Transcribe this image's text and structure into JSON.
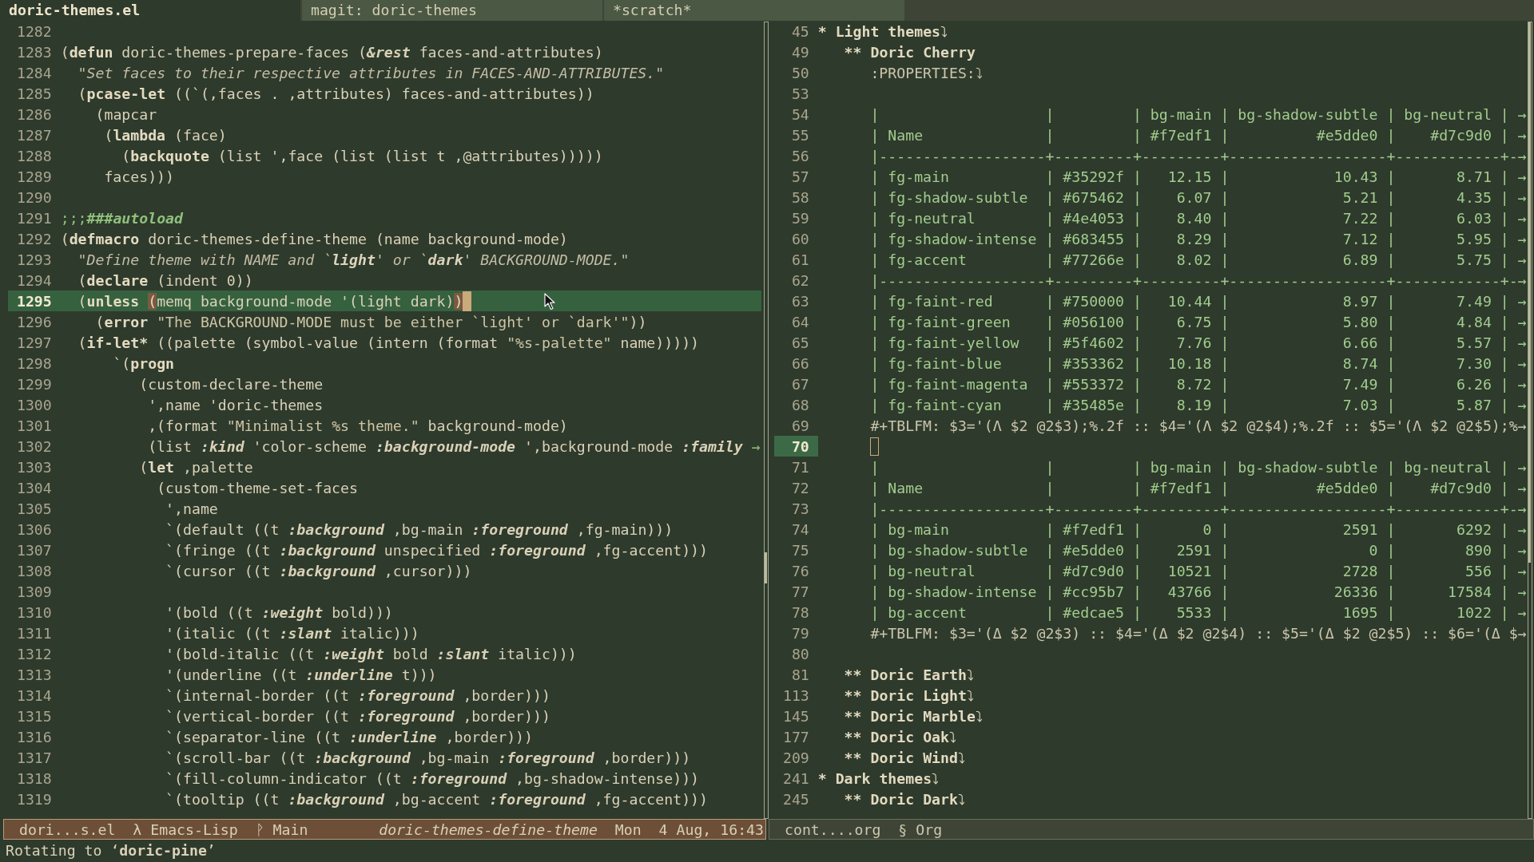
{
  "tab_bar": {
    "tabs": [
      {
        "label": "doric-themes.el",
        "selected": true
      },
      {
        "label": "magit: doric-themes",
        "selected": false
      },
      {
        "label": "*scratch*",
        "selected": false
      }
    ]
  },
  "left_window": {
    "active": true,
    "lines": [
      {
        "number": "1282",
        "current": false
      },
      {
        "number": "1283",
        "current": false,
        "segments": [
          {
            "kind": "plain",
            "text": "("
          },
          {
            "kind": "keyword",
            "text": "defun"
          },
          {
            "kind": "plain",
            "text": " doric-themes-prepare-faces ("
          },
          {
            "kind": "property",
            "text": "&rest"
          },
          {
            "kind": "plain",
            "text": " faces-and-attributes)"
          }
        ]
      },
      {
        "number": "1284",
        "current": false,
        "segments": [
          {
            "kind": "doc",
            "text": "  \"Set faces to their respective attributes in FACES-AND-ATTRIBUTES.\""
          }
        ]
      },
      {
        "number": "1285",
        "current": false,
        "segments": [
          {
            "kind": "plain",
            "text": "  ("
          },
          {
            "kind": "keyword",
            "text": "pcase-let"
          },
          {
            "kind": "plain",
            "text": " ((`(,faces . ,attributes) faces-and-attributes))"
          }
        ]
      },
      {
        "number": "1286",
        "current": false,
        "segments": [
          {
            "kind": "plain",
            "text": "    (mapcar"
          }
        ]
      },
      {
        "number": "1287",
        "current": false,
        "segments": [
          {
            "kind": "plain",
            "text": "     ("
          },
          {
            "kind": "keyword",
            "text": "lambda"
          },
          {
            "kind": "plain",
            "text": " (face)"
          }
        ]
      },
      {
        "number": "1288",
        "current": false,
        "segments": [
          {
            "kind": "plain",
            "text": "       ("
          },
          {
            "kind": "keyword",
            "text": "backquote"
          },
          {
            "kind": "plain",
            "text": " (list ',face (list (list t ,@attributes)))))"
          }
        ]
      },
      {
        "number": "1289",
        "current": false,
        "segments": [
          {
            "kind": "plain",
            "text": "     faces)))"
          }
        ]
      },
      {
        "number": "1290",
        "current": false
      },
      {
        "number": "1291",
        "current": false,
        "segments": [
          {
            "kind": "comment",
            "text": ";;;"
          },
          {
            "kind": "comment-bold",
            "text": "###autoload"
          }
        ]
      },
      {
        "number": "1292",
        "current": false,
        "segments": [
          {
            "kind": "plain",
            "text": "("
          },
          {
            "kind": "keyword",
            "text": "defmacro"
          },
          {
            "kind": "plain",
            "text": " doric-themes-define-theme (name background-mode)"
          }
        ]
      },
      {
        "number": "1293",
        "current": false,
        "segments": [
          {
            "kind": "doc",
            "text": "  \"Define theme with NAME and `"
          },
          {
            "kind": "doc-bold",
            "text": "light"
          },
          {
            "kind": "doc",
            "text": "' or `"
          },
          {
            "kind": "doc-bold",
            "text": "dark"
          },
          {
            "kind": "doc",
            "text": "' BACKGROUND-MODE.\""
          }
        ]
      },
      {
        "number": "1294",
        "current": false,
        "segments": [
          {
            "kind": "plain",
            "text": "  ("
          },
          {
            "kind": "keyword",
            "text": "declare"
          },
          {
            "kind": "plain",
            "text": " (indent 0))"
          }
        ]
      },
      {
        "number": "1295",
        "current": true,
        "segments": [
          {
            "kind": "plain",
            "text": "  ("
          },
          {
            "kind": "keyword",
            "text": "unless "
          },
          {
            "kind": "paren-match",
            "text": "("
          },
          {
            "kind": "plain",
            "text": "memq background-mode '(light dark)"
          },
          {
            "kind": "paren-match",
            "text": ")"
          }
        ]
      },
      {
        "number": "1296",
        "current": false,
        "segments": [
          {
            "kind": "plain",
            "text": "    ("
          },
          {
            "kind": "keyword",
            "text": "error "
          },
          {
            "kind": "string",
            "text": "\"The BACKGROUND-MODE must be either `light' or `dark'\""
          },
          {
            "kind": "plain",
            "text": "))"
          }
        ]
      },
      {
        "number": "1297",
        "current": false,
        "segments": [
          {
            "kind": "plain",
            "text": "  ("
          },
          {
            "kind": "keyword",
            "text": "if-let*"
          },
          {
            "kind": "plain",
            "text": " ((palette (symbol-value (intern (format "
          },
          {
            "kind": "string",
            "text": "\"%s-palette\""
          },
          {
            "kind": "plain",
            "text": " name)))))"
          }
        ]
      },
      {
        "number": "1298",
        "current": false,
        "segments": [
          {
            "kind": "plain",
            "text": "      `("
          },
          {
            "kind": "keyword",
            "text": "progn"
          }
        ]
      },
      {
        "number": "1299",
        "current": false,
        "segments": [
          {
            "kind": "plain",
            "text": "         (custom-declare-theme"
          }
        ]
      },
      {
        "number": "1300",
        "current": false,
        "segments": [
          {
            "kind": "plain",
            "text": "          ',name 'doric-themes"
          }
        ]
      },
      {
        "number": "1301",
        "current": false,
        "segments": [
          {
            "kind": "plain",
            "text": "          ,(format "
          },
          {
            "kind": "string",
            "text": "\"Minimalist %s theme.\""
          },
          {
            "kind": "plain",
            "text": " background-mode)"
          }
        ]
      },
      {
        "number": "1302",
        "current": false,
        "segments": [
          {
            "kind": "plain",
            "text": "          (list "
          },
          {
            "kind": "property",
            "text": ":kind"
          },
          {
            "kind": "plain",
            "text": " 'color-scheme "
          },
          {
            "kind": "property",
            "text": ":background-mode"
          },
          {
            "kind": "plain",
            "text": " ',background-mode "
          },
          {
            "kind": "property",
            "text": ":family "
          },
          {
            "kind": "truncation",
            "text": "→"
          }
        ]
      },
      {
        "number": "1303",
        "current": false,
        "segments": [
          {
            "kind": "plain",
            "text": "         ("
          },
          {
            "kind": "keyword",
            "text": "let"
          },
          {
            "kind": "plain",
            "text": " ,palette"
          }
        ]
      },
      {
        "number": "1304",
        "current": false,
        "segments": [
          {
            "kind": "plain",
            "text": "           (custom-theme-set-faces"
          }
        ]
      },
      {
        "number": "1305",
        "current": false,
        "segments": [
          {
            "kind": "plain",
            "text": "            ',name"
          }
        ]
      },
      {
        "number": "1306",
        "current": false,
        "segments": [
          {
            "kind": "plain",
            "text": "            `(default ((t "
          },
          {
            "kind": "property",
            "text": ":background"
          },
          {
            "kind": "plain",
            "text": " ,bg-main "
          },
          {
            "kind": "property",
            "text": ":foreground"
          },
          {
            "kind": "plain",
            "text": " ,fg-main)))"
          }
        ]
      },
      {
        "number": "1307",
        "current": false,
        "segments": [
          {
            "kind": "plain",
            "text": "            `(fringe ((t "
          },
          {
            "kind": "property",
            "text": ":background"
          },
          {
            "kind": "plain",
            "text": " unspecified "
          },
          {
            "kind": "property",
            "text": ":foreground"
          },
          {
            "kind": "plain",
            "text": " ,fg-accent)))"
          }
        ]
      },
      {
        "number": "1308",
        "current": false,
        "segments": [
          {
            "kind": "plain",
            "text": "            `(cursor ((t "
          },
          {
            "kind": "property",
            "text": ":background"
          },
          {
            "kind": "plain",
            "text": " ,cursor)))"
          }
        ]
      },
      {
        "number": "1309",
        "current": false
      },
      {
        "number": "1310",
        "current": false,
        "segments": [
          {
            "kind": "plain",
            "text": "            '(bold ((t "
          },
          {
            "kind": "property",
            "text": ":weight"
          },
          {
            "kind": "plain",
            "text": " bold)))"
          }
        ]
      },
      {
        "number": "1311",
        "current": false,
        "segments": [
          {
            "kind": "plain",
            "text": "            '(italic ((t "
          },
          {
            "kind": "property",
            "text": ":slant"
          },
          {
            "kind": "plain",
            "text": " italic)))"
          }
        ]
      },
      {
        "number": "1312",
        "current": false,
        "segments": [
          {
            "kind": "plain",
            "text": "            '(bold-italic ((t "
          },
          {
            "kind": "property",
            "text": ":weight"
          },
          {
            "kind": "plain",
            "text": " bold "
          },
          {
            "kind": "property",
            "text": ":slant"
          },
          {
            "kind": "plain",
            "text": " italic)))"
          }
        ]
      },
      {
        "number": "1313",
        "current": false,
        "segments": [
          {
            "kind": "plain",
            "text": "            '(underline ((t "
          },
          {
            "kind": "property",
            "text": ":underline"
          },
          {
            "kind": "plain",
            "text": " t)))"
          }
        ]
      },
      {
        "number": "1314",
        "current": false,
        "segments": [
          {
            "kind": "plain",
            "text": "            `(internal-border ((t "
          },
          {
            "kind": "property",
            "text": ":foreground"
          },
          {
            "kind": "plain",
            "text": " ,border)))"
          }
        ]
      },
      {
        "number": "1315",
        "current": false,
        "segments": [
          {
            "kind": "plain",
            "text": "            `(vertical-border ((t "
          },
          {
            "kind": "property",
            "text": ":foreground"
          },
          {
            "kind": "plain",
            "text": " ,border)))"
          }
        ]
      },
      {
        "number": "1316",
        "current": false,
        "segments": [
          {
            "kind": "plain",
            "text": "            `(separator-line ((t "
          },
          {
            "kind": "property",
            "text": ":underline"
          },
          {
            "kind": "plain",
            "text": " ,border)))"
          }
        ]
      },
      {
        "number": "1317",
        "current": false,
        "segments": [
          {
            "kind": "plain",
            "text": "            `(scroll-bar ((t "
          },
          {
            "kind": "property",
            "text": ":background"
          },
          {
            "kind": "plain",
            "text": " ,bg-main "
          },
          {
            "kind": "property",
            "text": ":foreground"
          },
          {
            "kind": "plain",
            "text": " ,border)))"
          }
        ]
      },
      {
        "number": "1318",
        "current": false,
        "segments": [
          {
            "kind": "plain",
            "text": "            `(fill-column-indicator ((t "
          },
          {
            "kind": "property",
            "text": ":foreground"
          },
          {
            "kind": "plain",
            "text": " ,bg-shadow-intense)))"
          }
        ]
      },
      {
        "number": "1319",
        "current": false,
        "segments": [
          {
            "kind": "plain",
            "text": "            `(tooltip ((t "
          },
          {
            "kind": "property",
            "text": ":background"
          },
          {
            "kind": "plain",
            "text": " ,bg-accent "
          },
          {
            "kind": "property",
            "text": ":foreground"
          },
          {
            "kind": "plain",
            "text": " ,fg-accent)))"
          }
        ]
      }
    ],
    "mode_line": {
      "buffer": "dori...s.el",
      "mode": "λ Emacs-Lisp",
      "branch": "ᚹ Main",
      "function": "doric-themes-define-theme",
      "date": "Mon  4 Aug, 16:43"
    }
  },
  "right_window": {
    "active": false,
    "lines": [
      {
        "number": "45",
        "kind": "heading",
        "text": "* Light themes",
        "ellipsis": "⤵",
        "current": false,
        "children": [
          {
            "number": "49",
            "kind": "heading",
            "text": "** Doric Cherry",
            "current": false,
            "children": [
              {
                "number": "50",
                "kind": "drawer",
                "text": ":PROPERTIES:",
                "ellipsis": "⤵",
                "current": false
              },
              {
                "number": "53",
                "kind": "blank",
                "current": false
              },
              {
                "number": "54",
                "kind": "table",
                "text": "|                   |         | bg-main | bg-shadow-subtle | bg-neutral | →",
                "current": false
              },
              {
                "number": "55",
                "kind": "table",
                "text": "| Name              |         | #f7edf1 |          #e5dde0 |    #d7c9d0 | →",
                "current": false
              },
              {
                "number": "56",
                "kind": "table",
                "text": "|-------------------+---------+---------+------------------+------------+-→",
                "current": false
              },
              {
                "number": "57",
                "kind": "table",
                "text": "| fg-main           | #35292f |   12.15 |            10.43 |       8.71 | →",
                "current": false
              },
              {
                "number": "58",
                "kind": "table",
                "text": "| fg-shadow-subtle  | #675462 |    6.07 |             5.21 |       4.35 | →",
                "current": false
              },
              {
                "number": "59",
                "kind": "table",
                "text": "| fg-neutral        | #4e4053 |    8.40 |             7.22 |       6.03 | →",
                "current": false
              },
              {
                "number": "60",
                "kind": "table",
                "text": "| fg-shadow-intense | #683455 |    8.29 |             7.12 |       5.95 | →",
                "current": false
              },
              {
                "number": "61",
                "kind": "table",
                "text": "| fg-accent         | #77266e |    8.02 |             6.89 |       5.75 | →",
                "current": false
              },
              {
                "number": "62",
                "kind": "table",
                "text": "|-------------------+---------+---------+------------------+------------+-→",
                "current": false
              },
              {
                "number": "63",
                "kind": "table",
                "text": "| fg-faint-red      | #750000 |   10.44 |             8.97 |       7.49 | →",
                "current": false
              },
              {
                "number": "64",
                "kind": "table",
                "text": "| fg-faint-green    | #056100 |    6.75 |             5.80 |       4.84 | →",
                "current": false
              },
              {
                "number": "65",
                "kind": "table",
                "text": "| fg-faint-yellow   | #5f4602 |    7.76 |             6.66 |       5.57 | →",
                "current": false
              },
              {
                "number": "66",
                "kind": "table",
                "text": "| fg-faint-blue     | #353362 |   10.18 |             8.74 |       7.30 | →",
                "current": false
              },
              {
                "number": "67",
                "kind": "table",
                "text": "| fg-faint-magenta  | #553372 |    8.72 |             7.49 |       6.26 | →",
                "current": false
              },
              {
                "number": "68",
                "kind": "table",
                "text": "| fg-faint-cyan     | #35485e |    8.19 |             7.03 |       5.87 | →",
                "current": false
              },
              {
                "number": "69",
                "kind": "formula",
                "text": "#+TBLFM: $3='(Λ $2 @2$3);%.2f :: $4='(Λ $2 @2$4);%.2f :: $5='(Λ $2 @2$5);%→",
                "current": false
              },
              {
                "number": "70",
                "kind": "blank",
                "current": true
              },
              {
                "number": "71",
                "kind": "table",
                "text": "|                   |         | bg-main | bg-shadow-subtle | bg-neutral | →",
                "current": false
              },
              {
                "number": "72",
                "kind": "table",
                "text": "| Name              |         | #f7edf1 |          #e5dde0 |    #d7c9d0 | →",
                "current": false
              },
              {
                "number": "73",
                "kind": "table",
                "text": "|-------------------+---------+---------+------------------+------------+-→",
                "current": false
              },
              {
                "number": "74",
                "kind": "table",
                "text": "| bg-main           | #f7edf1 |       0 |             2591 |       6292 | →",
                "current": false
              },
              {
                "number": "75",
                "kind": "table",
                "text": "| bg-shadow-subtle  | #e5dde0 |    2591 |                0 |        890 | →",
                "current": false
              },
              {
                "number": "76",
                "kind": "table",
                "text": "| bg-neutral        | #d7c9d0 |   10521 |             2728 |        556 | →",
                "current": false
              },
              {
                "number": "77",
                "kind": "table",
                "text": "| bg-shadow-intense | #cc95b7 |   43766 |            26336 |      17584 | →",
                "current": false
              },
              {
                "number": "78",
                "kind": "table",
                "text": "| bg-accent         | #edcae5 |    5533 |             1695 |       1022 | →",
                "current": false
              },
              {
                "number": "79",
                "kind": "formula",
                "text": "#+TBLFM: $3='(Δ $2 @2$3) :: $4='(Δ $2 @2$4) :: $5='(Δ $2 @2$5) :: $6='(Δ $→",
                "current": false
              },
              {
                "number": "80",
                "kind": "blank",
                "current": false
              }
            ]
          },
          {
            "number": "81",
            "kind": "heading",
            "text": "** Doric Earth",
            "ellipsis": "⤵",
            "current": false
          },
          {
            "number": "113",
            "kind": "heading",
            "text": "** Doric Light",
            "ellipsis": "⤵",
            "current": false
          },
          {
            "number": "145",
            "kind": "heading",
            "text": "** Doric Marble",
            "ellipsis": "⤵",
            "current": false
          },
          {
            "number": "177",
            "kind": "heading",
            "text": "** Doric Oak",
            "ellipsis": "⤵",
            "current": false
          },
          {
            "number": "209",
            "kind": "heading",
            "text": "** Doric Wind",
            "ellipsis": "⤵",
            "current": false
          }
        ]
      },
      {
        "number": "241",
        "kind": "heading",
        "text": "* Dark themes",
        "ellipsis": "⤵",
        "current": false,
        "children": [
          {
            "number": "245",
            "kind": "heading",
            "text": "** Doric Dark",
            "ellipsis": "⤵",
            "current": false
          }
        ]
      }
    ],
    "mode_line": {
      "buffer": "cont....org",
      "mode": "§ Org"
    }
  },
  "echo_area": {
    "message": "Rotating to ‘**doric-pine**’"
  }
}
